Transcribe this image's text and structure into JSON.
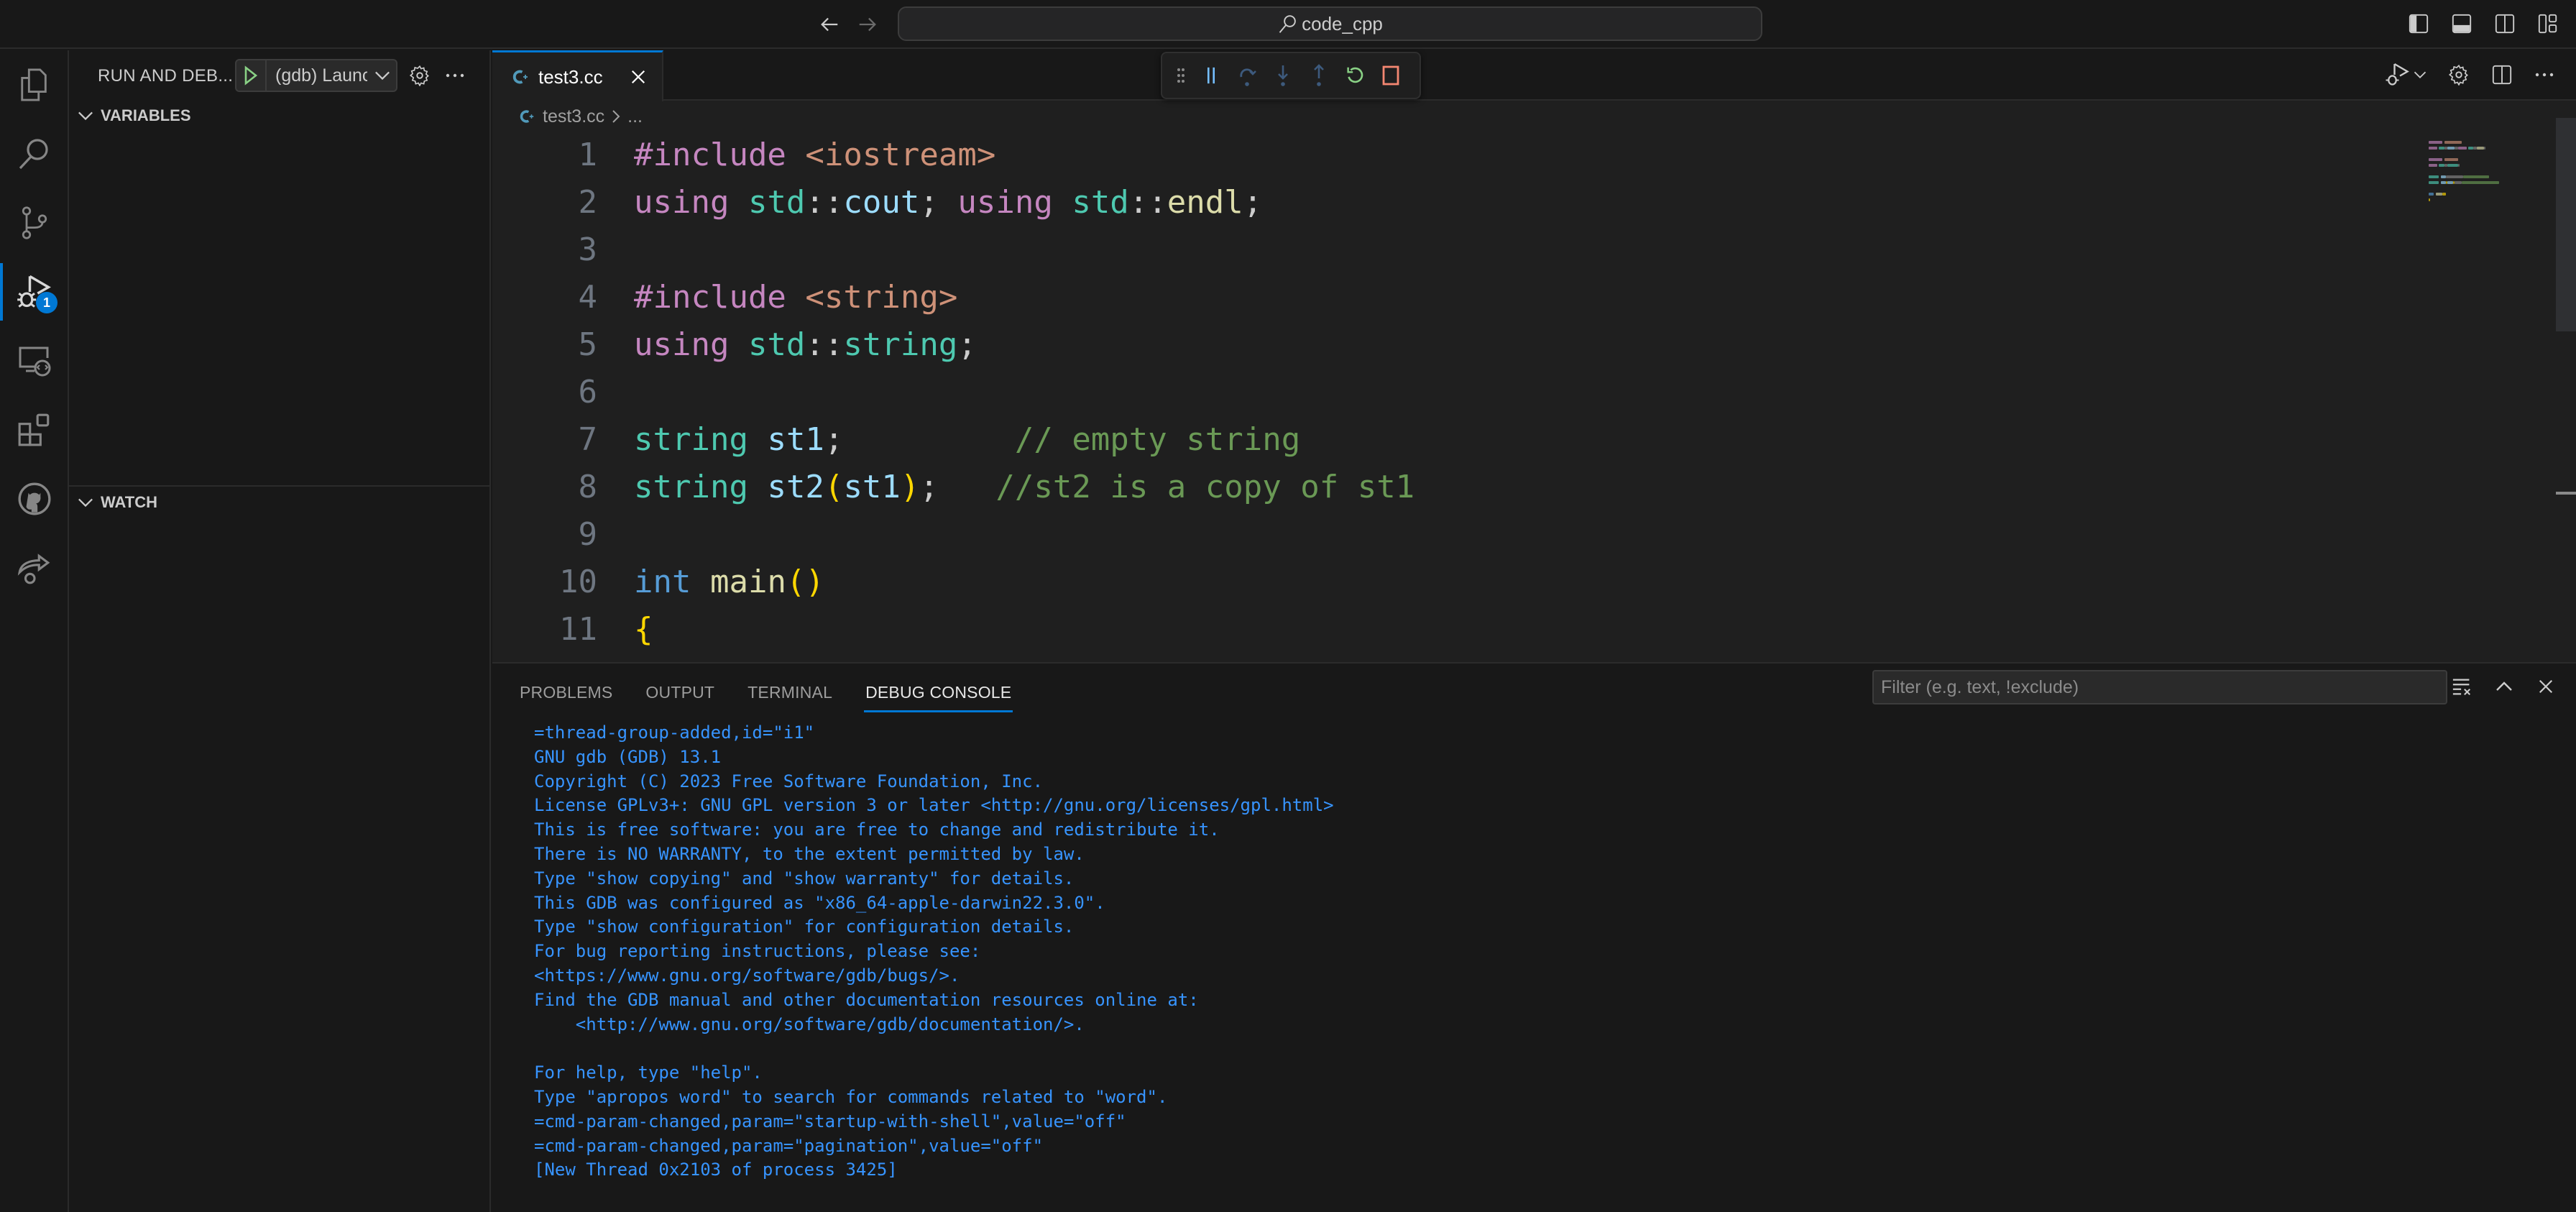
{
  "titlebar": {
    "search_text": "code_cpp",
    "back_icon": "arrow-left-icon",
    "forward_icon": "arrow-right-icon",
    "layout_icons": [
      "toggle-primary-sidebar-icon",
      "toggle-panel-icon",
      "toggle-secondary-sidebar-icon",
      "customize-layout-icon"
    ]
  },
  "activity_bar": {
    "items": [
      {
        "name": "explorer",
        "icon": "files-icon"
      },
      {
        "name": "search",
        "icon": "search-icon"
      },
      {
        "name": "source-control",
        "icon": "source-control-icon"
      },
      {
        "name": "run-and-debug",
        "icon": "debug-alt-icon",
        "badge": "1",
        "active": true
      },
      {
        "name": "remote-explorer",
        "icon": "remote-explorer-icon"
      },
      {
        "name": "extensions",
        "icon": "extensions-icon"
      },
      {
        "name": "github",
        "icon": "github-icon"
      },
      {
        "name": "live-share",
        "icon": "live-share-icon"
      }
    ]
  },
  "sidebar": {
    "title": "RUN AND DEB...",
    "launch_config": "(gdb) Launc",
    "sections": [
      {
        "label": "VARIABLES",
        "expanded": true
      },
      {
        "label": "WATCH",
        "expanded": true
      }
    ]
  },
  "editor": {
    "tab": {
      "label": "test3.cc",
      "icon": "cpp-file-icon"
    },
    "breadcrumb": {
      "file": "test3.cc",
      "rest": "..."
    },
    "debug_toolbar": [
      "drag-handle-icon",
      "pause-icon",
      "step-over-icon",
      "step-into-icon",
      "step-out-icon",
      "restart-icon",
      "stop-icon"
    ],
    "lines": [
      {
        "n": "1",
        "tokens": [
          [
            "kw",
            "#include"
          ],
          [
            "punc",
            " "
          ],
          [
            "inc",
            "<iostream>"
          ]
        ]
      },
      {
        "n": "2",
        "tokens": [
          [
            "kw",
            "using"
          ],
          [
            "punc",
            " "
          ],
          [
            "ns",
            "std"
          ],
          [
            "punc",
            "::"
          ],
          [
            "var",
            "cout"
          ],
          [
            "punc",
            "; "
          ],
          [
            "kw",
            "using"
          ],
          [
            "punc",
            " "
          ],
          [
            "ns",
            "std"
          ],
          [
            "punc",
            "::"
          ],
          [
            "fn",
            "endl"
          ],
          [
            "punc",
            ";"
          ]
        ]
      },
      {
        "n": "3",
        "tokens": []
      },
      {
        "n": "4",
        "tokens": [
          [
            "kw",
            "#include"
          ],
          [
            "punc",
            " "
          ],
          [
            "inc",
            "<string>"
          ]
        ]
      },
      {
        "n": "5",
        "tokens": [
          [
            "kw",
            "using"
          ],
          [
            "punc",
            " "
          ],
          [
            "ns",
            "std"
          ],
          [
            "punc",
            "::"
          ],
          [
            "ns",
            "string"
          ],
          [
            "punc",
            ";"
          ]
        ]
      },
      {
        "n": "6",
        "tokens": []
      },
      {
        "n": "7",
        "tokens": [
          [
            "ns",
            "string"
          ],
          [
            "punc",
            " "
          ],
          [
            "var",
            "st1"
          ],
          [
            "punc",
            ";         "
          ],
          [
            "cmt",
            "// empty string"
          ]
        ]
      },
      {
        "n": "8",
        "tokens": [
          [
            "ns",
            "string"
          ],
          [
            "punc",
            " "
          ],
          [
            "var",
            "st2"
          ],
          [
            "br",
            "("
          ],
          [
            "var",
            "st1"
          ],
          [
            "br",
            ")"
          ],
          [
            "punc",
            ";   "
          ],
          [
            "cmt",
            "//st2 is a copy of st1"
          ]
        ]
      },
      {
        "n": "9",
        "tokens": []
      },
      {
        "n": "10",
        "tokens": [
          [
            "type",
            "int"
          ],
          [
            "punc",
            " "
          ],
          [
            "fn",
            "main"
          ],
          [
            "br",
            "()"
          ]
        ]
      },
      {
        "n": "11",
        "tokens": [
          [
            "br",
            "{"
          ]
        ]
      }
    ]
  },
  "panel": {
    "tabs": [
      {
        "label": "PROBLEMS",
        "active": false
      },
      {
        "label": "OUTPUT",
        "active": false
      },
      {
        "label": "TERMINAL",
        "active": false
      },
      {
        "label": "DEBUG CONSOLE",
        "active": true
      }
    ],
    "filter_placeholder": "Filter (e.g. text, !exclude)",
    "filter_value": "",
    "console_lines": [
      "=thread-group-added,id=\"i1\"",
      "GNU gdb (GDB) 13.1",
      "Copyright (C) 2023 Free Software Foundation, Inc.",
      "License GPLv3+: GNU GPL version 3 or later <http://gnu.org/licenses/gpl.html>",
      "This is free software: you are free to change and redistribute it.",
      "There is NO WARRANTY, to the extent permitted by law.",
      "Type \"show copying\" and \"show warranty\" for details.",
      "This GDB was configured as \"x86_64-apple-darwin22.3.0\".",
      "Type \"show configuration\" for configuration details.",
      "For bug reporting instructions, please see:",
      "<https://www.gnu.org/software/gdb/bugs/>.",
      "Find the GDB manual and other documentation resources online at:",
      "    <http://www.gnu.org/software/gdb/documentation/>.",
      "",
      "For help, type \"help\".",
      "Type \"apropos word\" to search for commands related to \"word\".",
      "=cmd-param-changed,param=\"startup-with-shell\",value=\"off\"",
      "=cmd-param-changed,param=\"pagination\",value=\"off\"",
      "[New Thread 0x2103 of process 3425]"
    ]
  },
  "colors": {
    "accent": "#0078d4",
    "console_text": "#3794ff",
    "play_green": "#89d185",
    "stop_red": "#f48771"
  }
}
